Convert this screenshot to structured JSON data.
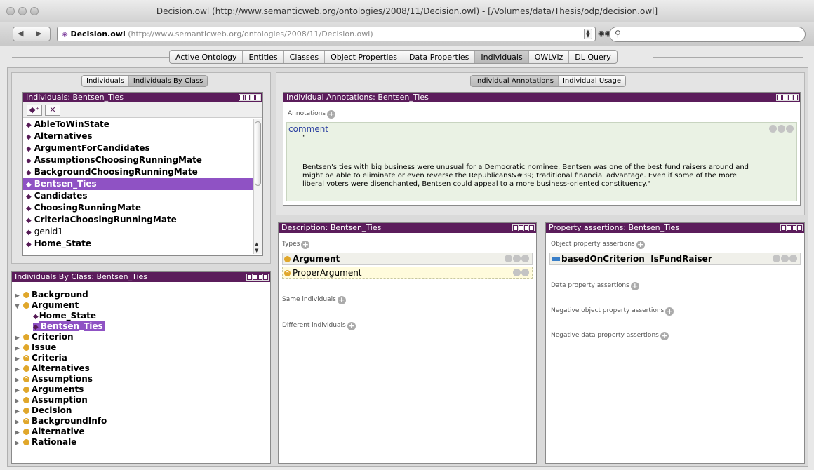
{
  "window": {
    "title": "Decision.owl (http://www.semanticweb.org/ontologies/2008/11/Decision.owl) - [/Volumes/data/Thesis/odp/decision.owl]"
  },
  "address": {
    "name": "Decision.owl",
    "url": "(http://www.semanticweb.org/ontologies/2008/11/Decision.owl)"
  },
  "tabs": [
    "Active Ontology",
    "Entities",
    "Classes",
    "Object Properties",
    "Data Properties",
    "Individuals",
    "OWLViz",
    "DL Query"
  ],
  "left_top": {
    "seg": [
      "Individuals",
      "Individuals By Class"
    ],
    "header": "Individuals: Bentsen_Ties",
    "items": [
      {
        "label": "AbleToWinState",
        "bold": true
      },
      {
        "label": "Alternatives",
        "bold": true
      },
      {
        "label": "ArgumentForCandidates",
        "bold": true
      },
      {
        "label": "AssumptionsChoosingRunningMate",
        "bold": true
      },
      {
        "label": "BackgroundChoosingRunningMate",
        "bold": true
      },
      {
        "label": "Bentsen_Ties",
        "bold": true,
        "selected": true
      },
      {
        "label": "Candidates",
        "bold": true
      },
      {
        "label": "ChoosingRunningMate",
        "bold": true
      },
      {
        "label": "CriteriaChoosingRunningMate",
        "bold": true
      },
      {
        "label": "genid1",
        "bold": false
      },
      {
        "label": "Home_State",
        "bold": true
      }
    ]
  },
  "left_bottom": {
    "header": "Individuals By Class: Bentsen_Ties",
    "tree": [
      {
        "label": "Background",
        "kind": "class",
        "arrow": "▶",
        "indent": 0
      },
      {
        "label": "Argument",
        "kind": "class",
        "arrow": "▼",
        "indent": 0
      },
      {
        "label": "Home_State",
        "kind": "individual",
        "arrow": "",
        "indent": 1
      },
      {
        "label": "Bentsen_Ties",
        "kind": "individual",
        "arrow": "",
        "indent": 1,
        "selected": true
      },
      {
        "label": "Criterion",
        "kind": "class",
        "arrow": "▶",
        "indent": 0
      },
      {
        "label": "Issue",
        "kind": "class",
        "arrow": "▶",
        "indent": 0
      },
      {
        "label": "Criteria",
        "kind": "eqclass",
        "arrow": "▶",
        "indent": 0
      },
      {
        "label": "Alternatives",
        "kind": "class",
        "arrow": "▶",
        "indent": 0
      },
      {
        "label": "Assumptions",
        "kind": "eqclass",
        "arrow": "▶",
        "indent": 0
      },
      {
        "label": "Arguments",
        "kind": "class",
        "arrow": "▶",
        "indent": 0
      },
      {
        "label": "Assumption",
        "kind": "class",
        "arrow": "▶",
        "indent": 0
      },
      {
        "label": "Decision",
        "kind": "class",
        "arrow": "▶",
        "indent": 0
      },
      {
        "label": "BackgroundInfo",
        "kind": "eqclass",
        "arrow": "▶",
        "indent": 0
      },
      {
        "label": "Alternative",
        "kind": "class",
        "arrow": "▶",
        "indent": 0
      },
      {
        "label": "Rationale",
        "kind": "class",
        "arrow": "▶",
        "indent": 0
      }
    ]
  },
  "annotations": {
    "seg": [
      "Individual Annotations",
      "Individual Usage"
    ],
    "header": "Individual Annotations: Bentsen_Ties",
    "section": "Annotations",
    "prop": "comment",
    "quote": "\"",
    "text": "Bentsen's ties with big business were unusual for a Democratic nominee. Bentsen was one of the best fund raisers around and might be able to eliminate or even reverse the Republicans&#39; traditional financial advantage. Even if some of the more liberal voters were disenchanted, Bentsen could appeal to a more business-oriented constituency.\""
  },
  "description": {
    "header": "Description: Bentsen_Ties",
    "types_label": "Types",
    "types": [
      "Argument",
      "ProperArgument"
    ],
    "same": "Same individuals",
    "different": "Different individuals"
  },
  "assertions": {
    "header": "Property assertions: Bentsen_Ties",
    "obj_label": "Object property assertions",
    "obj_prop": "basedOnCriterion",
    "obj_value": "IsFundRaiser",
    "data_label": "Data property assertions",
    "neg_obj_label": "Negative object property assertions",
    "neg_data_label": "Negative data property assertions"
  },
  "colors": {
    "header": "#5b1c5b",
    "selection": "#8f52c4",
    "class_dot": "#e0a72b",
    "object_prop": "#3a7fc8"
  }
}
